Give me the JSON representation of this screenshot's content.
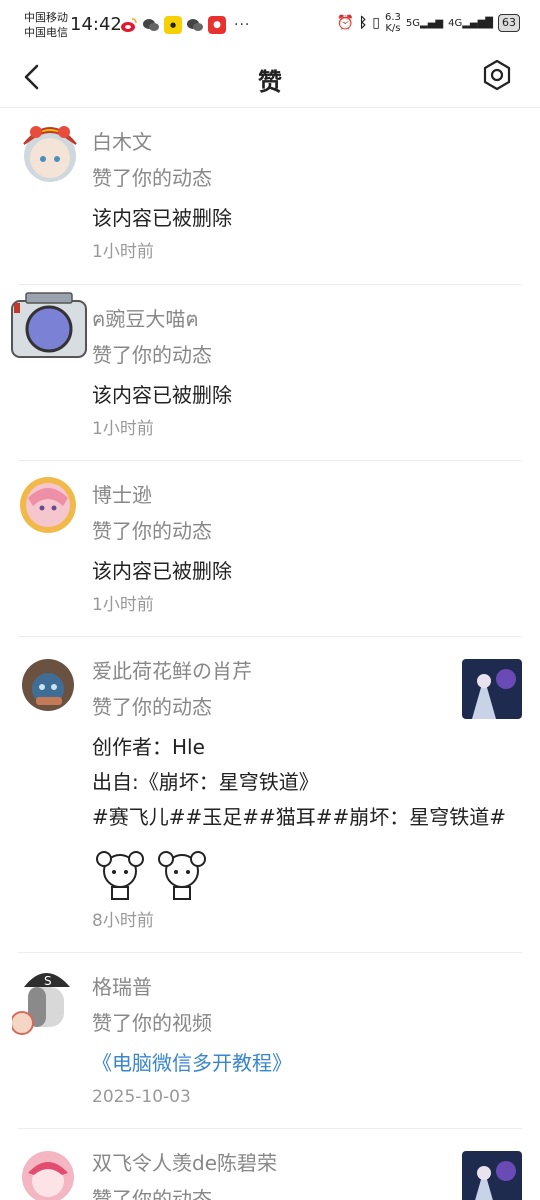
{
  "status_bar": {
    "carrier1": "中国移动",
    "carrier2": "中国电信",
    "time": "14:42",
    "more": "···",
    "net_speed": "6.3",
    "net_unit": "K/s",
    "sig1": "5G",
    "sig2": "4G",
    "battery": "63"
  },
  "header": {
    "title": "赞"
  },
  "feed": [
    {
      "user": "白木文",
      "action": "赞了你的动态",
      "content": "该内容已被删除",
      "time": "1小时前"
    },
    {
      "user": "ฅ豌豆大喵ฅ",
      "action": "赞了你的动态",
      "content": "该内容已被删除",
      "time": "1小时前"
    },
    {
      "user": "博士逊",
      "action": "赞了你的动态",
      "content": "该内容已被删除",
      "time": "1小时前"
    },
    {
      "user": "爱此荷花鲜の肖芹",
      "action": "赞了你的动态",
      "lines": [
        "创作者：Hle",
        "出自:《崩坏：星穹铁道》",
        "#赛飞儿##玉足##猫耳##崩坏：星穹铁道#"
      ],
      "time": "8小时前"
    },
    {
      "user": "格瑞普",
      "action": "赞了你的视频",
      "link": "《电脑微信多开教程》",
      "time": "2025-10-03"
    },
    {
      "user": "双飞令人羡de陈碧荣",
      "action": "赞了你的动态"
    }
  ],
  "colors": {
    "link": "#3a86cc",
    "secondary": "#888888",
    "divider": "#ececec"
  },
  "icons": [
    "back-arrow-icon",
    "settings-hexagon-icon"
  ]
}
